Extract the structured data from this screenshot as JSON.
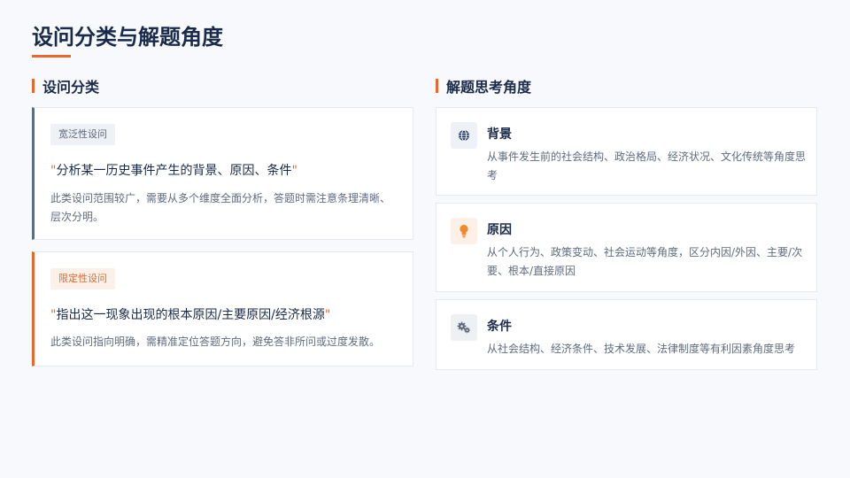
{
  "page": {
    "title": "设问分类与解题角度"
  },
  "left": {
    "heading": "设问分类",
    "cards": [
      {
        "tag": "宽泛性设问",
        "quote_open": "\"",
        "example": "分析某一历史事件产生的背景、原因、条件",
        "quote_close": "\"",
        "description": "此类设问范围较广，需要从多个维度全面分析，答题时需注意条理清晰、层次分明。"
      },
      {
        "tag": "限定性设问",
        "quote_open": "\"",
        "example": "指出这一现象出现的根本原因/主要原因/经济根源",
        "quote_close": "\"",
        "description": "此类设问指向明确，需精准定位答题方向，避免答非所问或过度发散。"
      }
    ]
  },
  "right": {
    "heading": "解题思考角度",
    "angles": [
      {
        "icon": "globe-icon",
        "title": "背景",
        "description": "从事件发生前的社会结构、政治格局、经济状况、文化传统等角度思考"
      },
      {
        "icon": "lightbulb-icon",
        "title": "原因",
        "description": "从个人行为、政策变动、社会运动等角度，区分内因/外因、主要/次要、根本/直接原因"
      },
      {
        "icon": "gears-icon",
        "title": "条件",
        "description": "从社会结构、经济条件、技术发展、法律制度等有利因素角度思考"
      }
    ]
  },
  "colors": {
    "accent": "#e8672a",
    "title": "#1a2a4a",
    "broad_border": "#5a6d84",
    "icon_blue": "#1f3a66",
    "icon_orange": "#f08a2c",
    "icon_gray": "#5a6578"
  }
}
